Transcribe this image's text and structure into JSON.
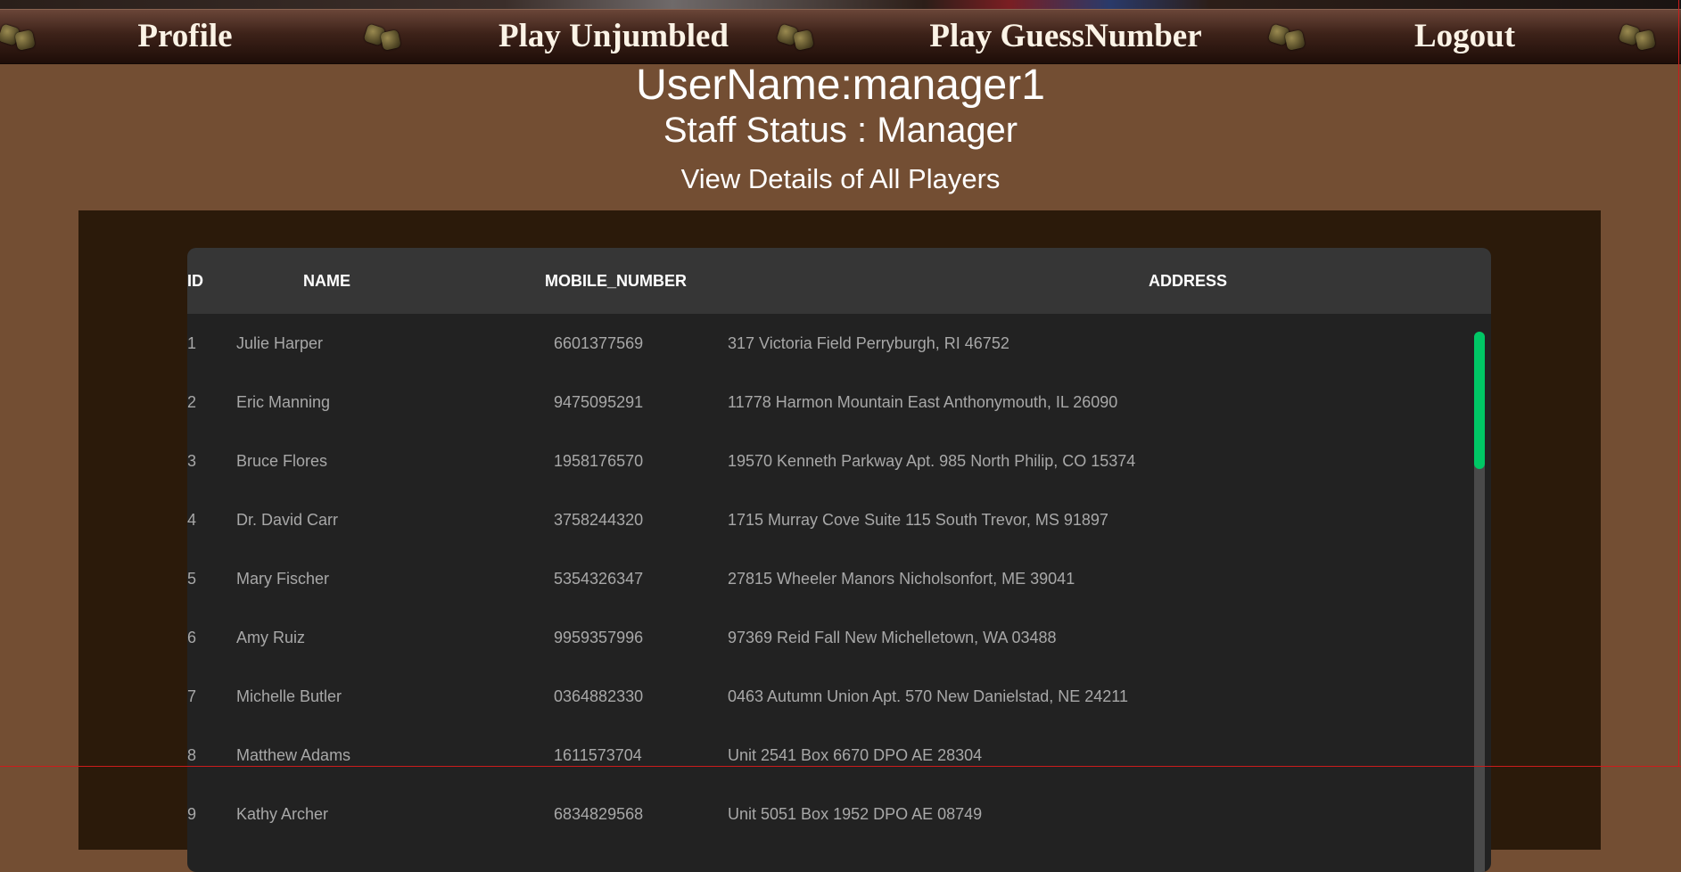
{
  "nav": {
    "items": [
      {
        "label": "Profile"
      },
      {
        "label": "Play Unjumbled"
      },
      {
        "label": "Play GuessNumber"
      },
      {
        "label": "Logout"
      }
    ]
  },
  "header": {
    "username": "UserName:manager1",
    "staff_status": "Staff Status : Manager",
    "view_title": "View Details of All Players"
  },
  "table": {
    "columns": [
      "ID",
      "NAME",
      "MOBILE_NUMBER",
      "ADDRESS"
    ],
    "rows": [
      {
        "id": "1",
        "name": "Julie Harper",
        "mobile": "6601377569",
        "address": "317 Victoria Field Perryburgh, RI 46752"
      },
      {
        "id": "2",
        "name": "Eric Manning",
        "mobile": "9475095291",
        "address": "11778 Harmon Mountain East Anthonymouth, IL 26090"
      },
      {
        "id": "3",
        "name": "Bruce Flores",
        "mobile": "1958176570",
        "address": "19570 Kenneth Parkway Apt. 985 North Philip, CO 15374"
      },
      {
        "id": "4",
        "name": "Dr. David Carr",
        "mobile": "3758244320",
        "address": "1715 Murray Cove Suite 115 South Trevor, MS 91897"
      },
      {
        "id": "5",
        "name": "Mary Fischer",
        "mobile": "5354326347",
        "address": "27815 Wheeler Manors Nicholsonfort, ME 39041"
      },
      {
        "id": "6",
        "name": "Amy Ruiz",
        "mobile": "9959357996",
        "address": "97369 Reid Fall New Michelletown, WA 03488"
      },
      {
        "id": "7",
        "name": "Michelle Butler",
        "mobile": "0364882330",
        "address": "0463 Autumn Union Apt. 570 New Danielstad, NE 24211"
      },
      {
        "id": "8",
        "name": "Matthew Adams",
        "mobile": "1611573704",
        "address": "Unit 2541 Box 6670 DPO AE 28304"
      },
      {
        "id": "9",
        "name": "Kathy Archer",
        "mobile": "6834829568",
        "address": "Unit 5051 Box 1952 DPO AE 08749"
      }
    ]
  },
  "colors": {
    "page_bg": "#734e33",
    "panel_bg": "#2b1a0a",
    "table_bg": "#222222",
    "header_bg": "#363636",
    "scroll_thumb": "#00c765"
  },
  "icons": [
    "dice-icon"
  ]
}
